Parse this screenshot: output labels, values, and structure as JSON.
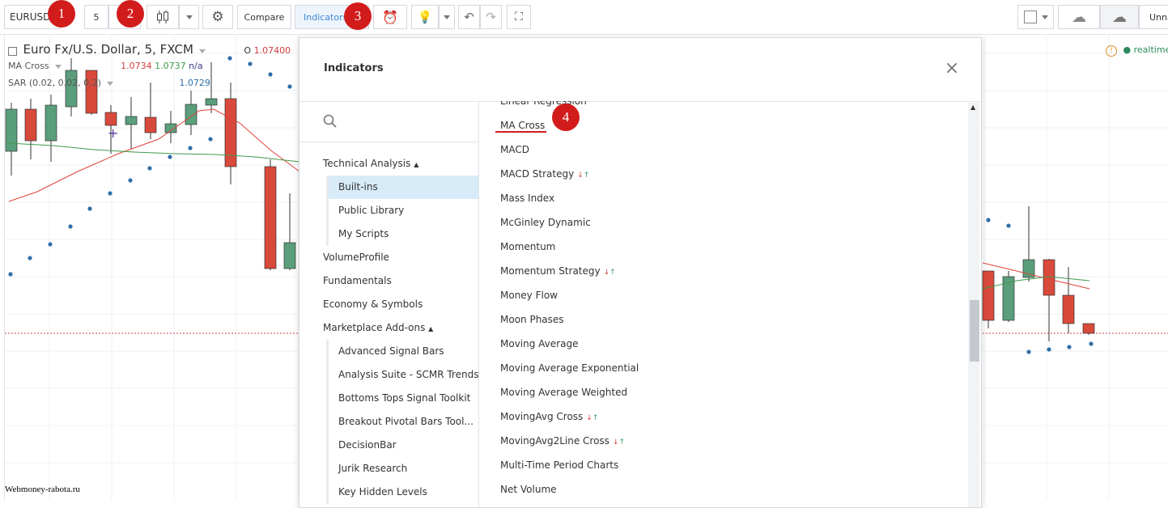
{
  "toolbar": {
    "symbol": "EURUSD",
    "interval": "5",
    "compare_label": "Compare",
    "indicators_label": "Indicators",
    "right_label": "Unna"
  },
  "badges": [
    "1",
    "2",
    "3",
    "4"
  ],
  "chart": {
    "title": "Euro Fx/U.S. Dollar, 5, FXCM",
    "open_label": "O",
    "open_value": "1.07400",
    "ma_label": "MA Cross",
    "ma_values": [
      "1.0734",
      "1.0737",
      "n/a"
    ],
    "sar_label": "SAR (0.02, 0.02, 0.2)",
    "sar_value": "1.0729",
    "realtime": "realtime",
    "colors": {
      "up": "#5a9e7b",
      "down": "#d9493b",
      "ma_fast": "#e0433a",
      "ma_slow": "#3f9a4a",
      "sar": "#2e6fa8"
    }
  },
  "watermark": "Webmoney-rabota.ru",
  "dialog": {
    "title": "Indicators",
    "close_icon": "close-icon",
    "search_icon": "search-icon",
    "nav": {
      "technical_analysis": "Technical Analysis",
      "builtins": "Built-ins",
      "public_library": "Public Library",
      "my_scripts": "My Scripts",
      "volume_profile": "VolumeProfile",
      "fundamentals": "Fundamentals",
      "economy_symbols": "Economy & Symbols",
      "marketplace": "Marketplace Add-ons",
      "addons": [
        "Advanced Signal Bars",
        "Analysis Suite - SCMR Trends",
        "Bottoms Tops Signal Toolkit",
        "Breakout Pivotal Bars Tool...",
        "DecisionBar",
        "Jurik Research",
        "Key Hidden Levels"
      ]
    },
    "list": [
      {
        "label": "Linear Regression",
        "strategy": false
      },
      {
        "label": "MA Cross",
        "strategy": false
      },
      {
        "label": "MACD",
        "strategy": false
      },
      {
        "label": "MACD Strategy",
        "strategy": true
      },
      {
        "label": "Mass Index",
        "strategy": false
      },
      {
        "label": "McGinley Dynamic",
        "strategy": false
      },
      {
        "label": "Momentum",
        "strategy": false
      },
      {
        "label": "Momentum Strategy",
        "strategy": true
      },
      {
        "label": "Money Flow",
        "strategy": false
      },
      {
        "label": "Moon Phases",
        "strategy": false
      },
      {
        "label": "Moving Average",
        "strategy": false
      },
      {
        "label": "Moving Average Exponential",
        "strategy": false
      },
      {
        "label": "Moving Average Weighted",
        "strategy": false
      },
      {
        "label": "MovingAvg Cross",
        "strategy": true
      },
      {
        "label": "MovingAvg2Line Cross",
        "strategy": true
      },
      {
        "label": "Multi-Time Period Charts",
        "strategy": false
      },
      {
        "label": "Net Volume",
        "strategy": false
      }
    ]
  }
}
